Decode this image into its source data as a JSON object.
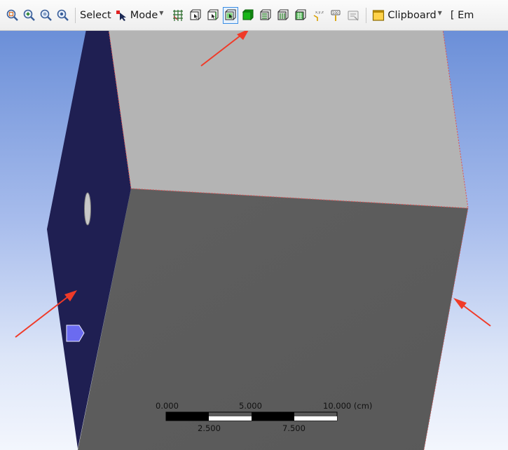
{
  "toolbar": {
    "zoom_buttons": [
      {
        "icon": "zoom-to-fit-icon"
      },
      {
        "icon": "zoom-in-icon"
      },
      {
        "icon": "zoom-out-icon"
      },
      {
        "icon": "zoom-box-icon"
      }
    ],
    "select_label": "Select",
    "mode_label": "Mode",
    "clipboard_label": "Clipboard",
    "trailing_label": "[ Em",
    "active_button": "select-faces-button",
    "accent_color": "#3a8ee6"
  },
  "viewport": {
    "background_top": "#6b8fd8",
    "background_bottom": "#f3f6fd",
    "face_colors": {
      "top": "#b5b5b5",
      "front": "#5c5c5c",
      "left_selected": "#1f1f52",
      "marker": "#6b6bf0"
    }
  },
  "scale_bar": {
    "top_labels": [
      "0.000",
      "5.000",
      "10.000 (cm)"
    ],
    "bottom_labels": [
      "2.500",
      "7.500"
    ]
  }
}
